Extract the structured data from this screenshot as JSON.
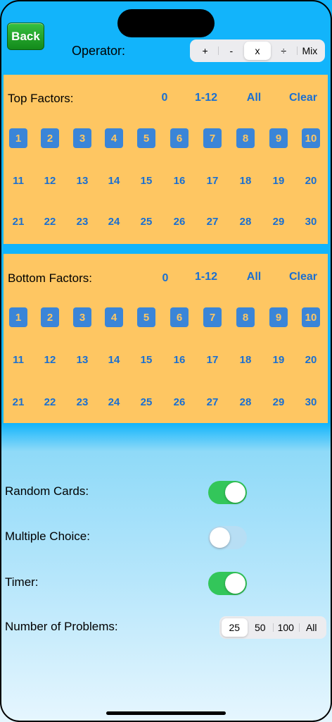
{
  "back_label": "Back",
  "operator": {
    "label": "Operator:",
    "options": [
      "+",
      "-",
      "x",
      "÷",
      "Mix"
    ],
    "selected": "x"
  },
  "top_factors": {
    "title": "Top Factors:",
    "links": [
      "0",
      "1-12",
      "All",
      "Clear"
    ],
    "numbers": [
      "1",
      "2",
      "3",
      "4",
      "5",
      "6",
      "7",
      "8",
      "9",
      "10",
      "11",
      "12",
      "13",
      "14",
      "15",
      "16",
      "17",
      "18",
      "19",
      "20",
      "21",
      "22",
      "23",
      "24",
      "25",
      "26",
      "27",
      "28",
      "29",
      "30"
    ],
    "selected": [
      "1",
      "2",
      "3",
      "4",
      "5",
      "6",
      "7",
      "8",
      "9",
      "10"
    ]
  },
  "bottom_factors": {
    "title": "Bottom Factors:",
    "links": [
      "0",
      "1-12",
      "All",
      "Clear"
    ],
    "numbers": [
      "1",
      "2",
      "3",
      "4",
      "5",
      "6",
      "7",
      "8",
      "9",
      "10",
      "11",
      "12",
      "13",
      "14",
      "15",
      "16",
      "17",
      "18",
      "19",
      "20",
      "21",
      "22",
      "23",
      "24",
      "25",
      "26",
      "27",
      "28",
      "29",
      "30"
    ],
    "selected": [
      "1",
      "2",
      "3",
      "4",
      "5",
      "6",
      "7",
      "8",
      "9",
      "10"
    ]
  },
  "settings": {
    "random_cards": {
      "label": "Random Cards:",
      "on": true
    },
    "multiple_choice": {
      "label": "Multiple Choice:",
      "on": false
    },
    "timer": {
      "label": "Timer:",
      "on": true
    },
    "number_of_problems": {
      "label": "Number of Problems:",
      "options": [
        "25",
        "50",
        "100",
        "All"
      ],
      "selected": "25"
    }
  },
  "colors": {
    "panel": "#fec662",
    "accent_blue": "#1a6fd1",
    "toggle_on": "#33c65a",
    "back_green": "#1f9a27"
  }
}
